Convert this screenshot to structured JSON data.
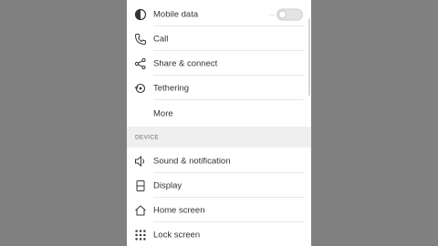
{
  "network": {
    "items": [
      {
        "label": "Mobile data",
        "icon": "mobile-data-icon"
      },
      {
        "label": "Call",
        "icon": "phone-icon"
      },
      {
        "label": "Share & connect",
        "icon": "share-icon"
      },
      {
        "label": "Tethering",
        "icon": "tethering-icon"
      },
      {
        "label": "More",
        "icon": ""
      }
    ],
    "mobile_data_enabled": false
  },
  "device": {
    "header": "DEVICE",
    "items": [
      {
        "label": "Sound & notification",
        "icon": "speaker-icon"
      },
      {
        "label": "Display",
        "icon": "display-icon"
      },
      {
        "label": "Home screen",
        "icon": "home-icon"
      },
      {
        "label": "Lock screen",
        "icon": "lock-screen-icon"
      }
    ]
  },
  "colors": {
    "background": "#808080",
    "panel": "#ffffff",
    "section_header_bg": "#efefef",
    "text": "#333333"
  }
}
